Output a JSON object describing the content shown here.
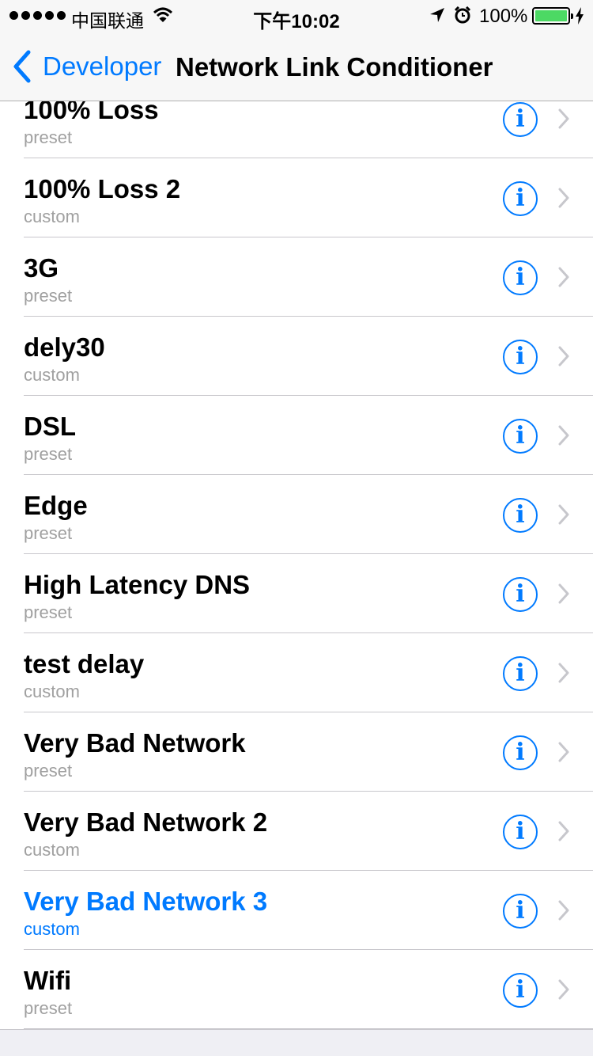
{
  "status_bar": {
    "carrier": "中国联通",
    "time": "下午10:02",
    "battery_percent": "100%",
    "battery_level": 1.0,
    "icons": [
      "signal-dots-icon",
      "wifi-icon",
      "location-arrow-icon",
      "alarm-clock-icon",
      "battery-icon",
      "charging-bolt-icon"
    ]
  },
  "nav": {
    "back_label": "Developer",
    "title": "Network Link Conditioner"
  },
  "colors": {
    "accent": "#007aff",
    "subtitle": "#a0a0a0",
    "battery": "#4cd964",
    "separator": "#c8c7cc"
  },
  "profiles": [
    {
      "name": "100% Loss",
      "type": "preset"
    },
    {
      "name": "100% Loss 2",
      "type": "custom"
    },
    {
      "name": "3G",
      "type": "preset"
    },
    {
      "name": "dely30",
      "type": "custom"
    },
    {
      "name": "DSL",
      "type": "preset"
    },
    {
      "name": "Edge",
      "type": "preset"
    },
    {
      "name": "High Latency DNS",
      "type": "preset"
    },
    {
      "name": "test delay",
      "type": "custom"
    },
    {
      "name": "Very Bad Network",
      "type": "preset"
    },
    {
      "name": "Very Bad Network 2",
      "type": "custom"
    },
    {
      "name": "Very Bad Network 3",
      "type": "custom",
      "selected": true
    },
    {
      "name": "Wifi",
      "type": "preset"
    }
  ],
  "info_glyph": "i"
}
